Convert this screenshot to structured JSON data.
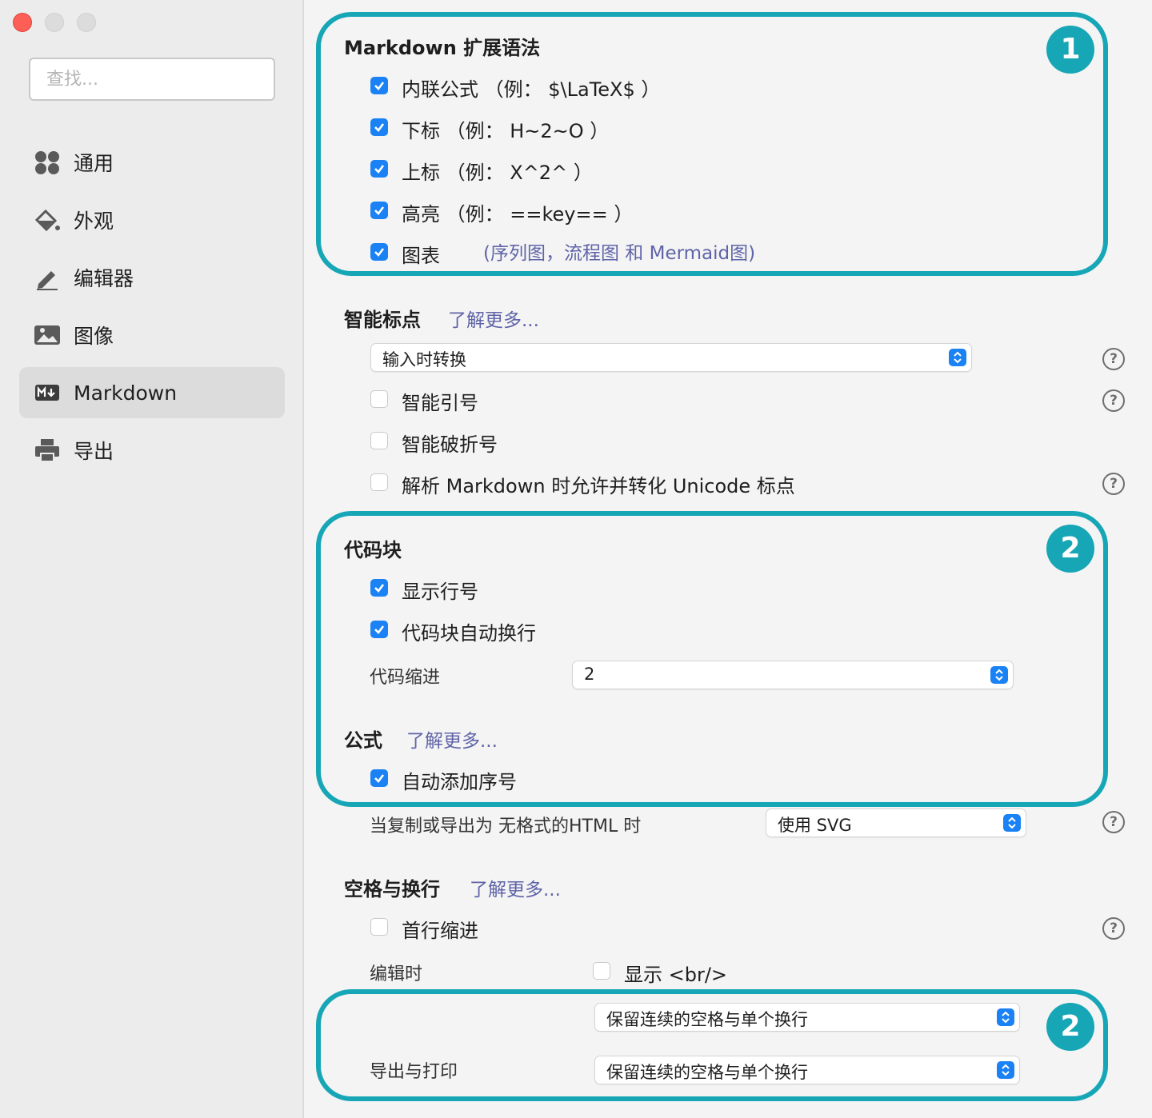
{
  "search": {
    "placeholder": "查找..."
  },
  "sidebar": {
    "items": [
      {
        "label": "通用",
        "icon": "grid-icon"
      },
      {
        "label": "外观",
        "icon": "paint-bucket-icon"
      },
      {
        "label": "编辑器",
        "icon": "pencil-icon"
      },
      {
        "label": "图像",
        "icon": "image-icon"
      },
      {
        "label": "Markdown",
        "icon": "markdown-icon",
        "active": true
      },
      {
        "label": "导出",
        "icon": "printer-icon"
      }
    ]
  },
  "markdown_ext": {
    "title": "Markdown 扩展语法",
    "inline_math": {
      "label": "内联公式 （例： $\\LaTeX$ ）",
      "checked": true
    },
    "subscript": {
      "label": "下标 （例： H~2~O ）",
      "checked": true
    },
    "superscript": {
      "label": "上标 （例： X^2^ ）",
      "checked": true
    },
    "highlight": {
      "label": "高亮 （例： ==key== ）",
      "checked": true
    },
    "diagrams": {
      "label": "图表",
      "note": "(序列图，流程图 和 Mermaid图)",
      "checked": true
    }
  },
  "smart_punct": {
    "title": "智能标点",
    "learn_more": "了解更多...",
    "select_value": "输入时转换",
    "smart_quotes": {
      "label": "智能引号",
      "checked": false
    },
    "smart_dashes": {
      "label": "智能破折号",
      "checked": false
    },
    "unicode": {
      "label": "解析 Markdown 时允许并转化 Unicode 标点",
      "checked": false
    }
  },
  "code_block": {
    "title": "代码块",
    "line_numbers": {
      "label": "显示行号",
      "checked": true
    },
    "wrap": {
      "label": "代码块自动换行",
      "checked": true
    },
    "indent_label": "代码缩进",
    "indent_value": "2"
  },
  "math": {
    "title": "公式",
    "learn_more": "了解更多...",
    "auto_number": {
      "label": "自动添加序号",
      "checked": true
    },
    "export_label": "当复制或导出为 无格式的HTML 时",
    "export_value": "使用 SVG"
  },
  "whitespace": {
    "title": "空格与换行",
    "learn_more": "了解更多...",
    "first_indent": {
      "label": "首行缩进",
      "checked": false
    },
    "editing_label": "编辑时",
    "show_br": {
      "label": "显示 <br/>",
      "checked": false
    },
    "edit_select": "保留连续的空格与单个换行",
    "export_label": "导出与打印",
    "export_select": "保留连续的空格与单个换行"
  },
  "badges": [
    "1",
    "2",
    "2"
  ],
  "help_mark": "?",
  "colors": {
    "accent": "#16a6b6",
    "checkbox": "#1a82f5",
    "link": "#5f64a8"
  }
}
